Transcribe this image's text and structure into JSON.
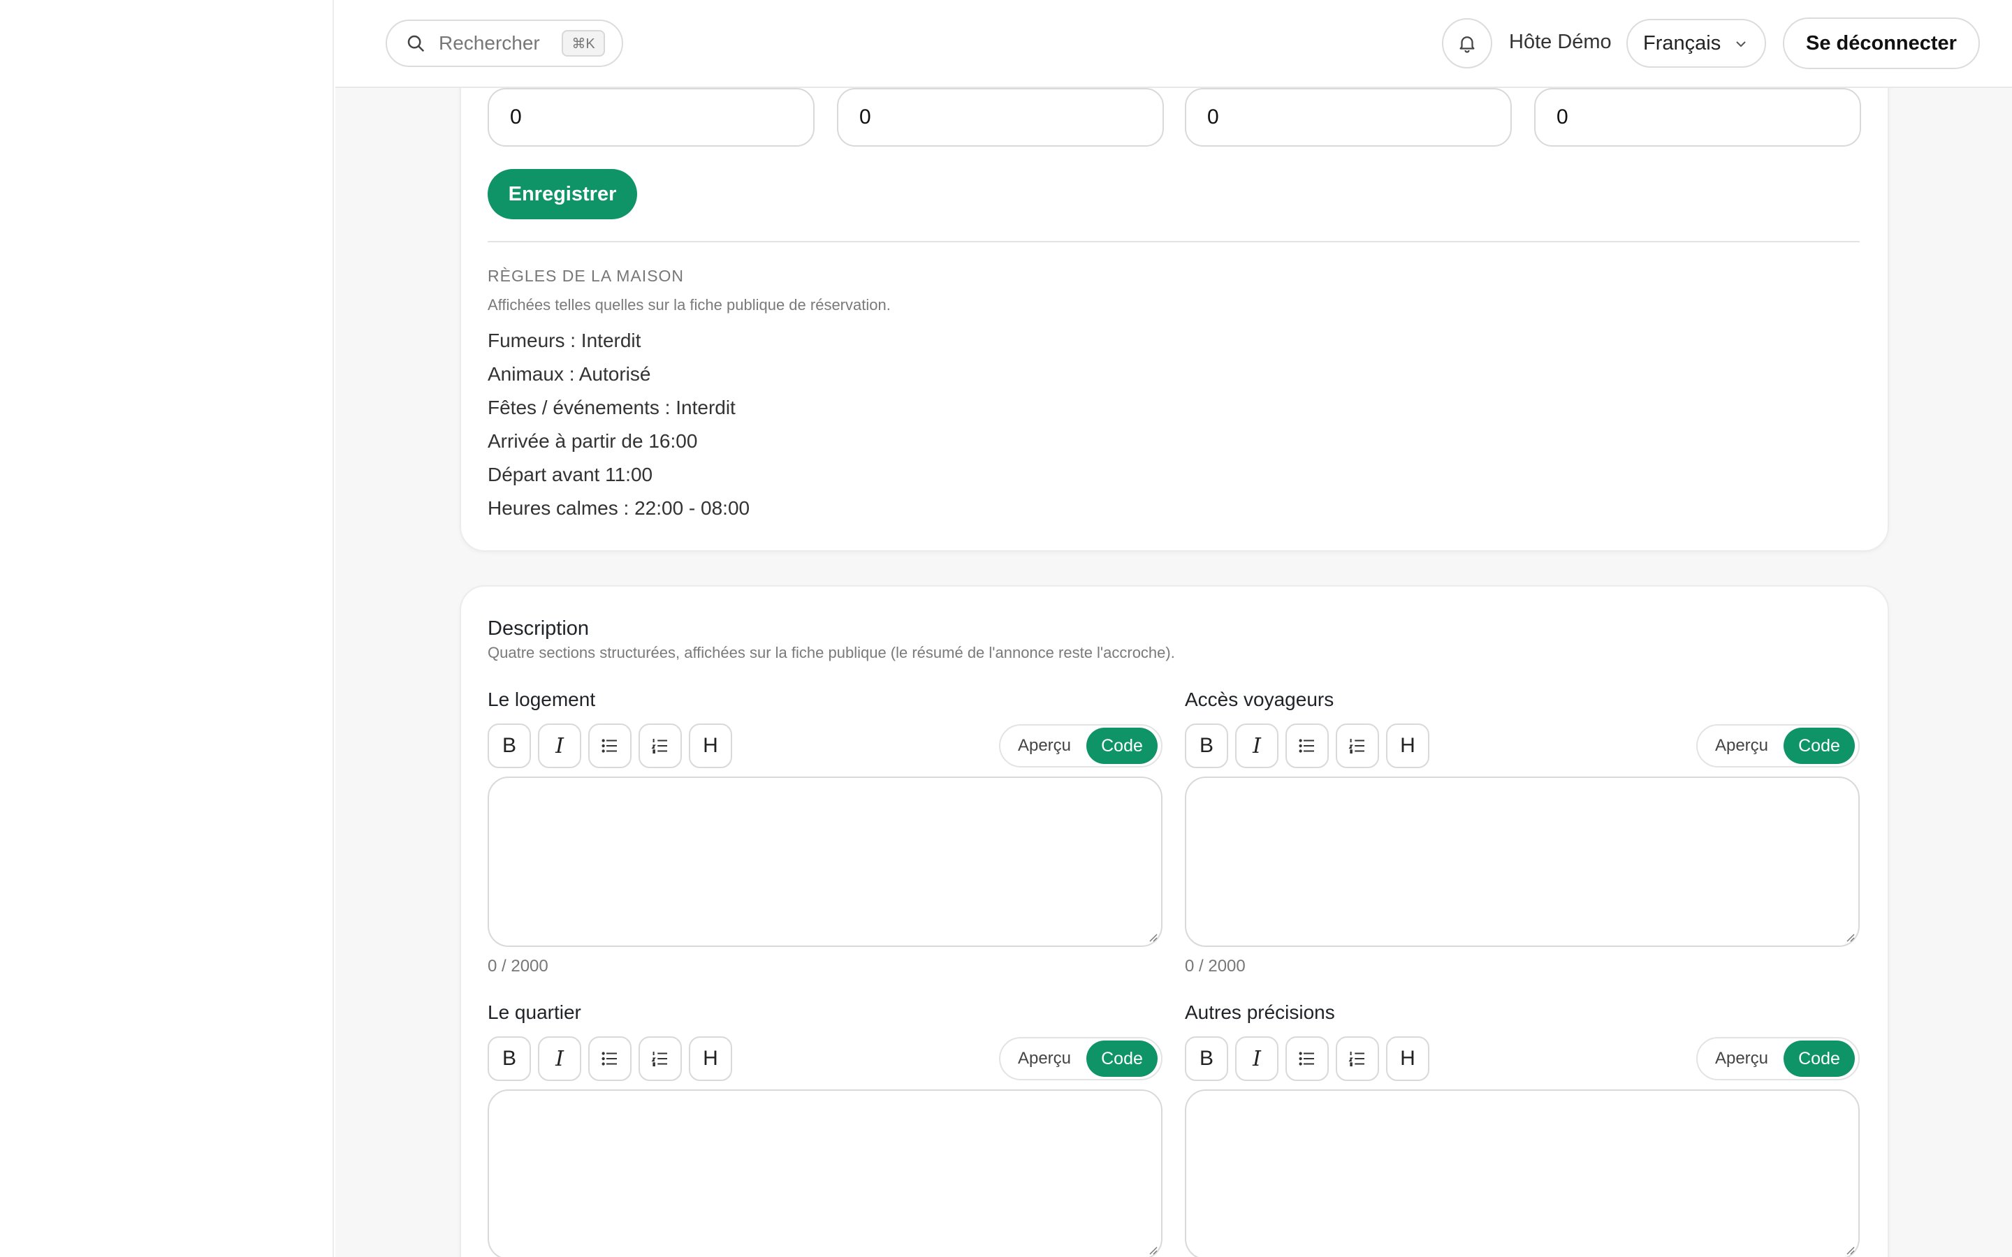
{
  "header": {
    "search_placeholder": "Rechercher",
    "search_shortcut": "⌘K",
    "host_name": "Hôte Démo",
    "language": "Français",
    "logout_label": "Se déconnecter"
  },
  "pricing": {
    "inputs": [
      "0",
      "0",
      "0",
      "0"
    ],
    "save_label": "Enregistrer"
  },
  "house_rules": {
    "title": "RÈGLES DE LA MAISON",
    "subtitle": "Affichées telles quelles sur la fiche publique de réservation.",
    "items": [
      "Fumeurs : Interdit",
      "Animaux : Autorisé",
      "Fêtes / événements : Interdit",
      "Arrivée à partir de 16:00",
      "Départ avant 11:00",
      "Heures calmes : 22:00 - 08:00"
    ]
  },
  "description": {
    "title": "Description",
    "subtitle": "Quatre sections structurées, affichées sur la fiche publique (le résumé de l'annonce reste l'accroche).",
    "toolbar": {
      "bold": "B",
      "italic": "I",
      "heading": "H"
    },
    "toggle": {
      "preview": "Aperçu",
      "code": "Code"
    },
    "sections": [
      {
        "label": "Le logement",
        "counter": "0 / 2000"
      },
      {
        "label": "Accès voyageurs",
        "counter": "0 / 2000"
      },
      {
        "label": "Le quartier"
      },
      {
        "label": "Autres précisions"
      }
    ]
  },
  "colors": {
    "accent": "#0e9466",
    "border": "#d9d9d9",
    "muted_text": "#7a7a7a"
  }
}
